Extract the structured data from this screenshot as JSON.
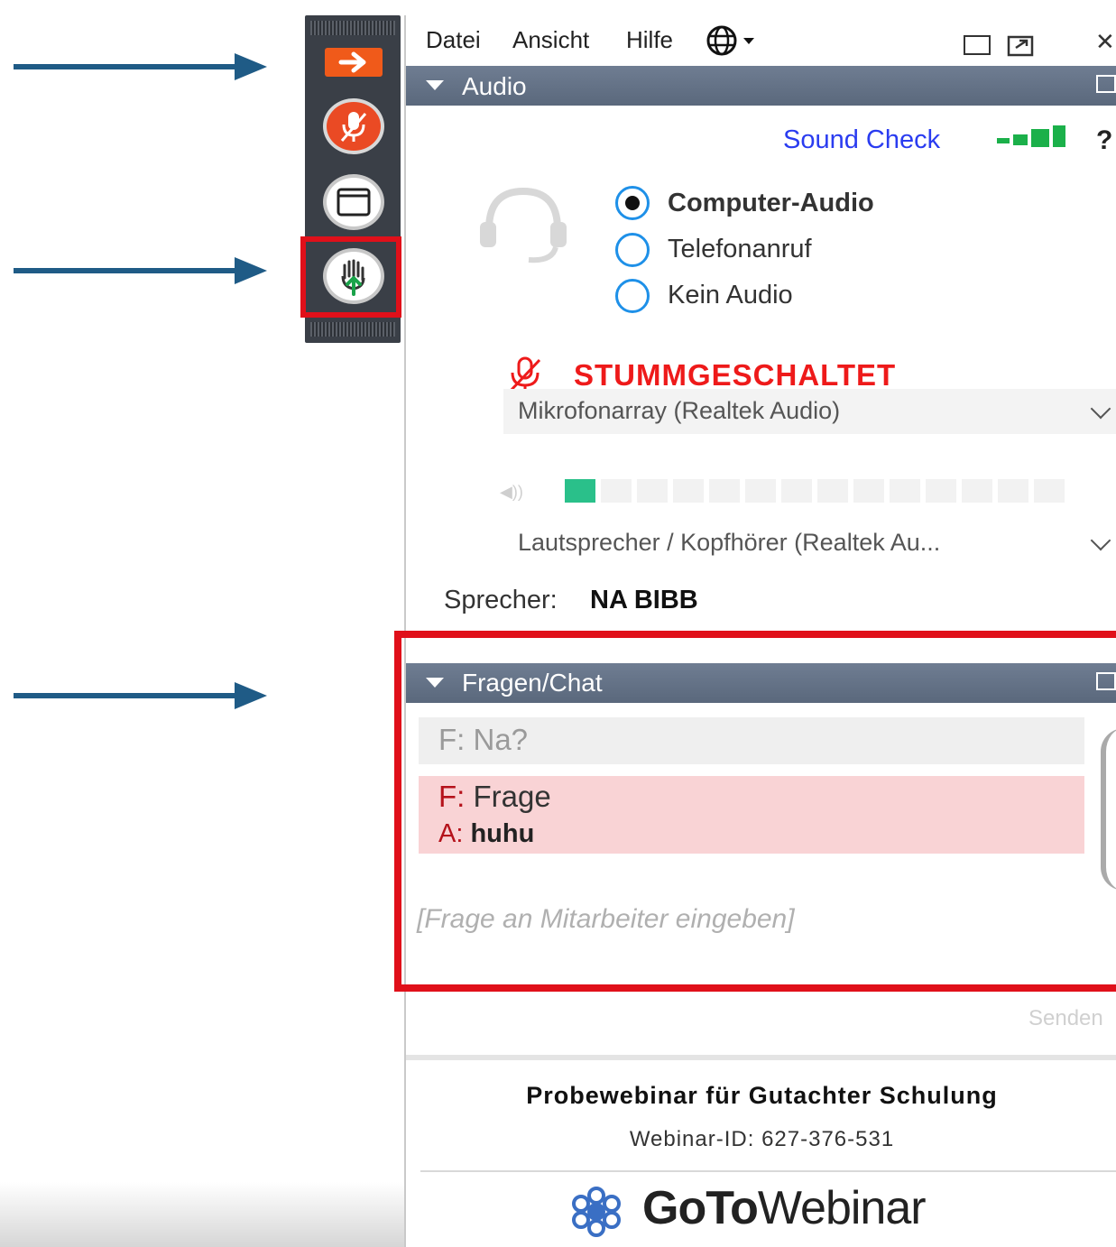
{
  "menu": {
    "file": "Datei",
    "view": "Ansicht",
    "help": "Hilfe"
  },
  "window_controls": {
    "close": "✕"
  },
  "audio": {
    "title": "Audio",
    "sound_check": "Sound Check",
    "help": "?",
    "options": [
      {
        "label": "Computer-Audio",
        "selected": true
      },
      {
        "label": "Telefonanruf",
        "selected": false
      },
      {
        "label": "Kein Audio",
        "selected": false
      }
    ],
    "muted_status": "STUMMGESCHALTET",
    "microphone": "Mikrofonarray (Realtek Audio)",
    "speaker_device": "Lautsprecher / Kopfhörer (Realtek Au...",
    "speaker_label": "Sprecher:",
    "speaker_name": "NA BIBB",
    "mic_level_fraction": 0.06
  },
  "chat": {
    "title": "Fragen/Chat",
    "items": [
      {
        "question": "F: Na?",
        "answer": ""
      },
      {
        "question_prefix": "F: ",
        "question": "Frage",
        "answer_prefix": "A: ",
        "answer": "huhu"
      }
    ],
    "input_placeholder": "[Frage an Mitarbeiter eingeben]",
    "send_label": "Senden"
  },
  "footer": {
    "webinar_title": "Probewebinar für Gutachter Schulung",
    "webinar_id": "Webinar-ID: 627-376-531",
    "logo_goto": "GoTo",
    "logo_webinar": "Webinar"
  },
  "colors": {
    "accent_red": "#e0101a",
    "arrow_blue": "#1f5b86",
    "link_blue": "#2a3cf0",
    "muted_red": "#ee1a1a",
    "header_slate": "#5a687c",
    "level_green": "#2ac08a"
  },
  "icons": [
    "arrow-right-icon",
    "mic-muted-icon",
    "screen-icon",
    "raise-hand-icon",
    "globe-icon",
    "headset-icon",
    "logo-icon"
  ]
}
